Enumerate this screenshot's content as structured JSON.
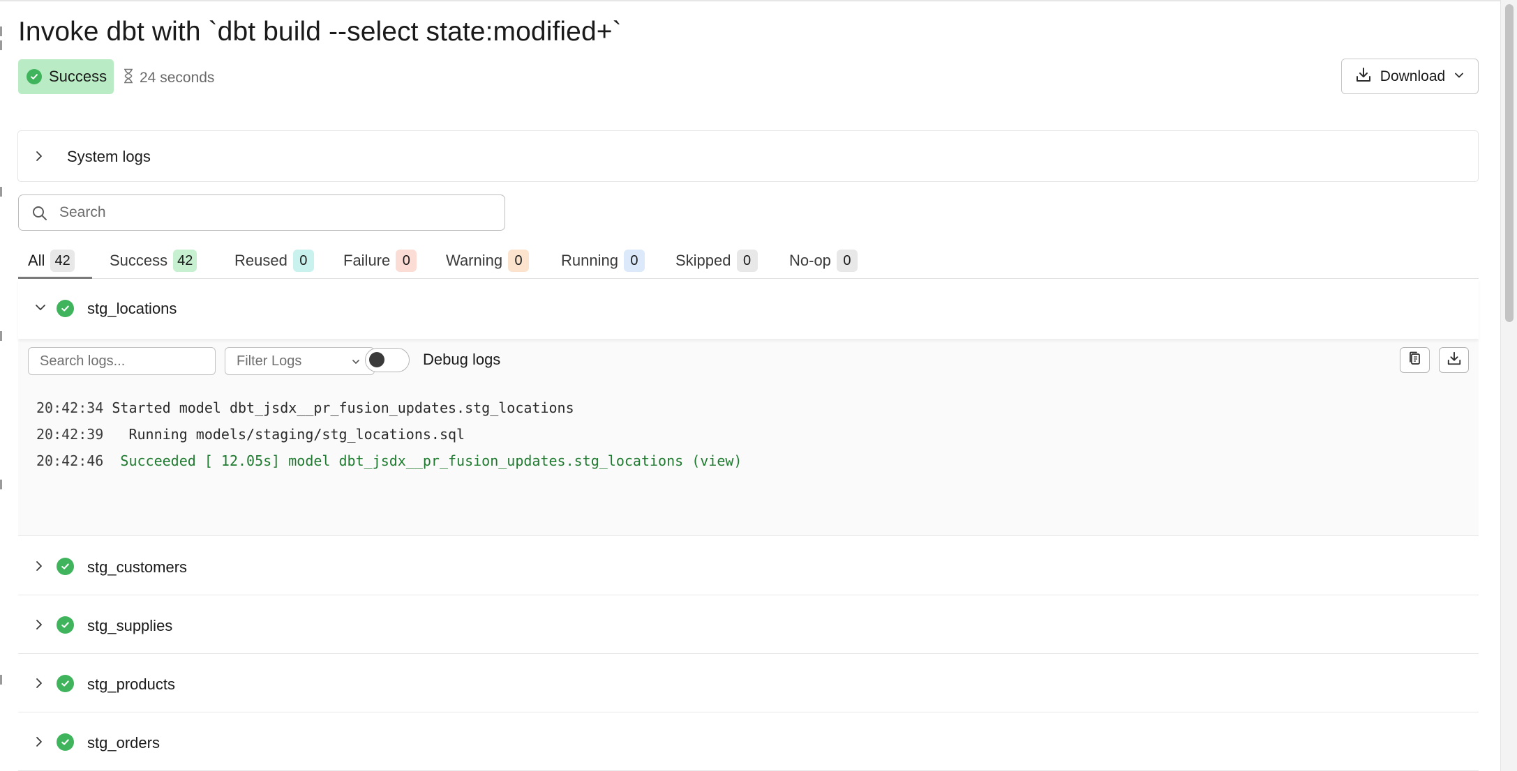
{
  "header": {
    "title": "Invoke dbt with `dbt build --select state:modified+`",
    "status": "Success",
    "duration": "24 seconds",
    "download_label": "Download"
  },
  "system_logs": {
    "label": "System logs"
  },
  "search": {
    "placeholder": "Search"
  },
  "tabs": [
    {
      "label": "All",
      "count": "42",
      "color": "#e8e8e8"
    },
    {
      "label": "Success",
      "count": "42",
      "color": "#c6f0cf"
    },
    {
      "label": "Reused",
      "count": "0",
      "color": "#c9f2ee"
    },
    {
      "label": "Failure",
      "count": "0",
      "color": "#fbddd6"
    },
    {
      "label": "Warning",
      "count": "0",
      "color": "#fbe3cd"
    },
    {
      "label": "Running",
      "count": "0",
      "color": "#dbe9fb"
    },
    {
      "label": "Skipped",
      "count": "0",
      "color": "#e8e8e8"
    },
    {
      "label": "No-op",
      "count": "0",
      "color": "#e8e8e8"
    }
  ],
  "expanded_model": {
    "name": "stg_locations",
    "log_search_placeholder": "Search logs...",
    "filter_label": "Filter Logs",
    "debug_label": "Debug logs",
    "lines": [
      {
        "time": "20:42:34",
        "message": "Started model dbt_jsdx__pr_fusion_updates.stg_locations"
      },
      {
        "time": "20:42:39",
        "message": "  Running models/staging/stg_locations.sql"
      },
      {
        "time": "20:42:46",
        "message": " Succeeded [ 12.05s] model dbt_jsdx__pr_fusion_updates.stg_locations (view)"
      }
    ]
  },
  "models": [
    {
      "name": "stg_customers"
    },
    {
      "name": "stg_supplies"
    },
    {
      "name": "stg_products"
    },
    {
      "name": "stg_orders"
    }
  ],
  "colors": {
    "success_green": "#3fb45c",
    "success_badge": "#b9ecc4",
    "log_success_text": "#1e7a2e"
  }
}
